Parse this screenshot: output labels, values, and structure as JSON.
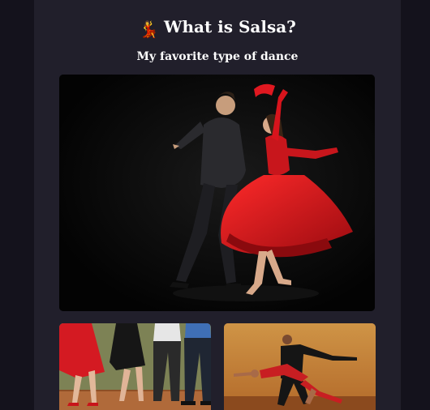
{
  "header": {
    "emoji": "💃",
    "title": "What is Salsa?",
    "subtitle": "My favorite type of dance"
  },
  "images": {
    "hero": "salsa-couple-dancing-photo",
    "thumb_left": "dancers-feet-on-floor-photo",
    "thumb_right": "salsa-dip-pose-photo"
  },
  "colors": {
    "background": "#14121c",
    "panel": "#211f2b",
    "text": "#ffffff",
    "dress_red": "#d8141c"
  }
}
